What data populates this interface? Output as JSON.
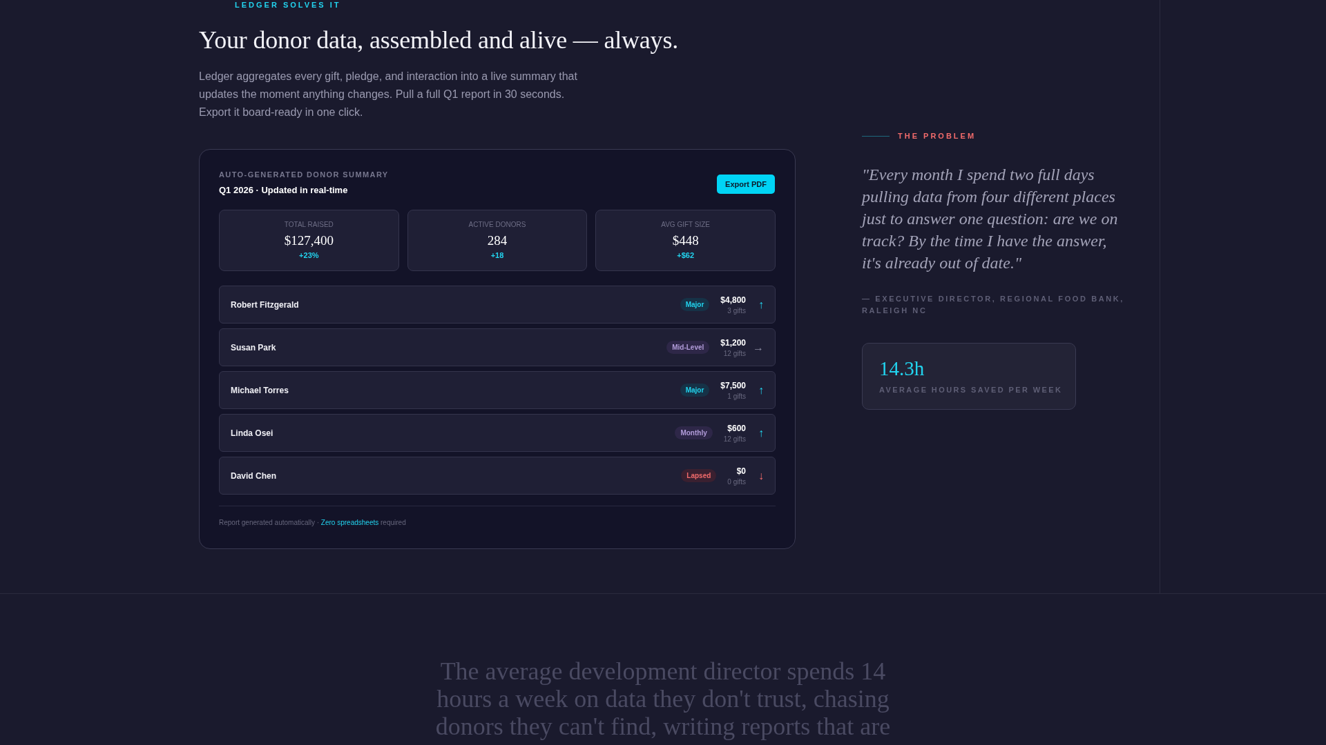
{
  "eyebrow": "LEDGER SOLVES IT",
  "headline": "Your donor data, assembled and alive — always.",
  "intro": "Ledger aggregates every gift, pledge, and interaction into a live summary that updates the moment anything changes. Pull a full Q1 report in 30 seconds. Export it board-ready in one click.",
  "summary": {
    "label": "AUTO-GENERATED DONOR SUMMARY",
    "title": "Q1 2026 · Updated in real-time",
    "export_button": "Export PDF",
    "stats": [
      {
        "label": "TOTAL RAISED",
        "value": "$127,400",
        "change": "+23%"
      },
      {
        "label": "ACTIVE DONORS",
        "value": "284",
        "change": "+18"
      },
      {
        "label": "AVG GIFT SIZE",
        "value": "$448",
        "change": "+$62"
      }
    ],
    "donors": [
      {
        "name": "Robert Fitzgerald",
        "kind": "major",
        "tag": "Major",
        "amount": "$4,800",
        "gifts": "3 gifts",
        "trend": "↑"
      },
      {
        "name": "Susan Park",
        "kind": "midlevel",
        "tag": "Mid-Level",
        "amount": "$1,200",
        "gifts": "12 gifts",
        "trend": "→"
      },
      {
        "name": "Michael Torres",
        "kind": "major",
        "tag": "Major",
        "amount": "$7,500",
        "gifts": "1 gifts",
        "trend": "↑"
      },
      {
        "name": "Linda Osei",
        "kind": "monthly",
        "tag": "Monthly",
        "amount": "$600",
        "gifts": "12 gifts",
        "trend": "↑"
      },
      {
        "name": "David Chen",
        "kind": "lapsed",
        "tag": "Lapsed",
        "amount": "$0",
        "gifts": "0 gifts",
        "trend": "↓"
      }
    ],
    "footer": "Report generated automatically · **Zero spreadsheets** required"
  },
  "problem": {
    "label": "THE PROBLEM",
    "quote": "\"Every month I spend two full days pulling data from four different places just to answer one question: are we on track? By the time I have the answer, it's already out of date.\"",
    "attribution": "— EXECUTIVE DIRECTOR, REGIONAL FOOD BANK, RALEIGH NC",
    "stat_value": "14.3h",
    "stat_label": "AVERAGE HOURS SAVED PER WEEK"
  },
  "closing": "The average development director spends 14 hours a week on data they don't trust, chasing donors they can't find, writing reports that are"
}
